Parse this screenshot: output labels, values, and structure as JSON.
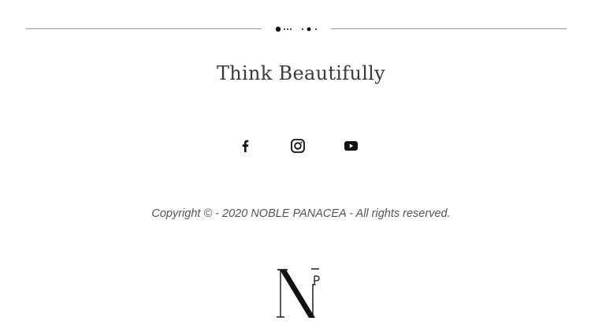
{
  "footer": {
    "tagline": "Think Beautifully",
    "social": [
      {
        "icon": "facebook-icon",
        "label": "Facebook"
      },
      {
        "icon": "instagram-icon",
        "label": "Instagram"
      },
      {
        "icon": "youtube-icon",
        "label": "YouTube"
      }
    ],
    "copyright": "Copyright © - 2020 NOBLE PANACEA - All rights reserved.",
    "logo": {
      "letters": "NP"
    }
  },
  "colors": {
    "text": "#3a3a3a",
    "muted": "#555555",
    "divider": "#9a9a9a",
    "icon": "#111111"
  }
}
